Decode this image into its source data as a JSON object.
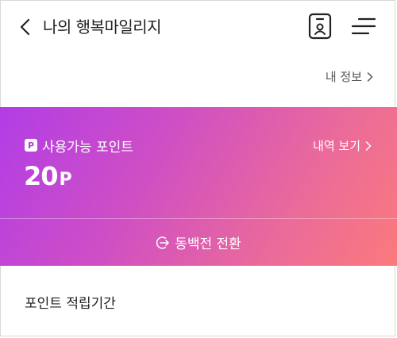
{
  "header": {
    "title": "나의 행복마일리지",
    "back_icon": "chevron-left-icon",
    "member_card_icon": "member-id-card-icon",
    "menu_icon": "hamburger-menu-icon"
  },
  "my_info": {
    "label": "내 정보",
    "icon": "chevron-right-icon"
  },
  "points_card": {
    "badge": "P",
    "label": "사용가능 포인트",
    "history_label": "내역 보기",
    "value": "20",
    "unit": "P",
    "convert_label": "동백전 전환",
    "convert_icon": "convert-arrow-icon",
    "gradient_start": "#b23de6",
    "gradient_end": "#fb7a7c"
  },
  "section": {
    "title": "포인트 적립기간"
  }
}
